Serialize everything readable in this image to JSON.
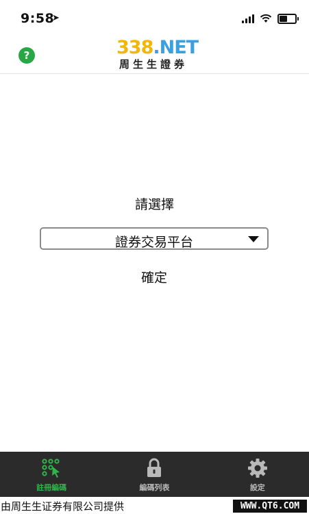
{
  "status_bar": {
    "time": "9:58",
    "location_icon": "location-arrow-icon",
    "signal_icon": "cellular-signal-icon",
    "wifi_icon": "wifi-icon",
    "battery_icon": "battery-icon",
    "battery_level": 0.45
  },
  "header": {
    "help_label": "?",
    "logo": {
      "main_number": "338",
      "main_suffix": ".NET",
      "sub": "周生生證券"
    },
    "colors": {
      "help": "#28a745",
      "logo_number": "#f2b705",
      "logo_suffix": "#3aa0e0"
    }
  },
  "main": {
    "prompt": "請選擇",
    "select": {
      "value": "證券交易平台",
      "icon": "dropdown-triangle-icon"
    },
    "confirm_label": "確定"
  },
  "tabbar": {
    "tabs": [
      {
        "label": "註冊編碼",
        "icon": "keypad-register-icon",
        "active": true
      },
      {
        "label": "編碼列表",
        "icon": "lock-icon",
        "active": false
      },
      {
        "label": "設定",
        "icon": "gear-icon",
        "active": false
      }
    ],
    "colors": {
      "background": "#2b2b2b",
      "active": "#31b44a",
      "inactive": "#b9b9b9"
    }
  },
  "footer": {
    "provider_text": "由周生生证券有限公司提供",
    "watermark": "WWW.QT6.COM"
  }
}
